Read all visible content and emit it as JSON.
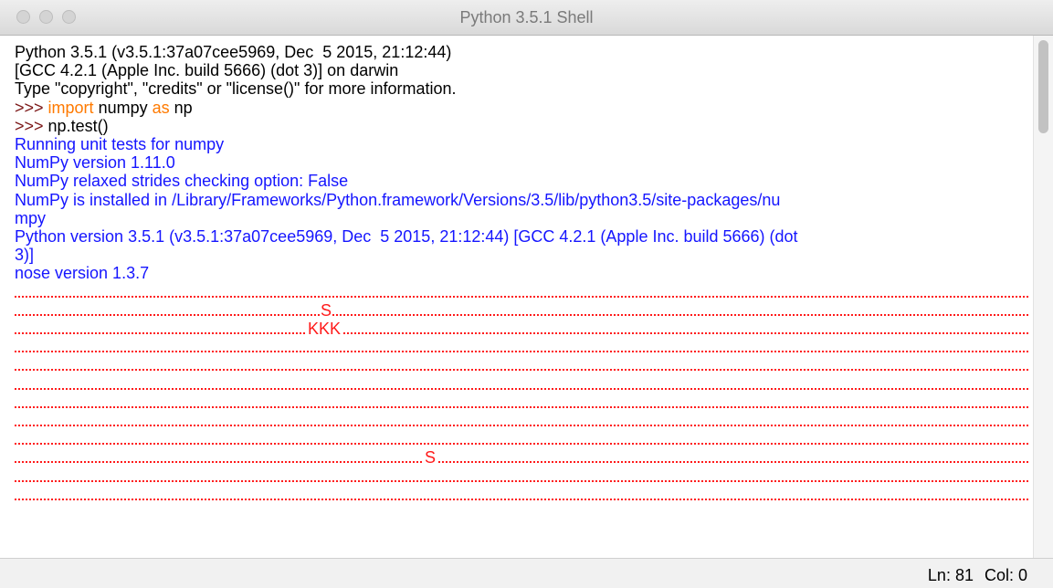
{
  "window": {
    "title": "Python 3.5.1 Shell"
  },
  "shell": {
    "banner_1": "Python 3.5.1 (v3.5.1:37a07cee5969, Dec  5 2015, 21:12:44) ",
    "banner_2": "[GCC 4.2.1 (Apple Inc. build 5666) (dot 3)] on darwin",
    "banner_3": "Type \"copyright\", \"credits\" or \"license()\" for more information.",
    "prompt": ">>> ",
    "cmd1_kw1": "import",
    "cmd1_mid": " numpy ",
    "cmd1_kw2": "as",
    "cmd1_end": " np",
    "cmd2": "np.test()",
    "out_1": "Running unit tests for numpy",
    "out_2": "NumPy version 1.11.0",
    "out_3": "NumPy relaxed strides checking option: False",
    "out_4": "NumPy is installed in /Library/Frameworks/Python.framework/Versions/3.5/lib/python3.5/site-packages/nu",
    "out_5": "mpy",
    "out_6": "Python version 3.5.1 (v3.5.1:37a07cee5969, Dec  5 2015, 21:12:44) [GCC 4.2.1 (Apple Inc. build 5666) (dot",
    "out_7": "3)]",
    "out_8": "nose version 1.3.7",
    "marker_s1": "S",
    "marker_k": "KKK",
    "marker_s2": "S"
  },
  "status": {
    "ln": "Ln: 81",
    "col": "Col: 0"
  }
}
